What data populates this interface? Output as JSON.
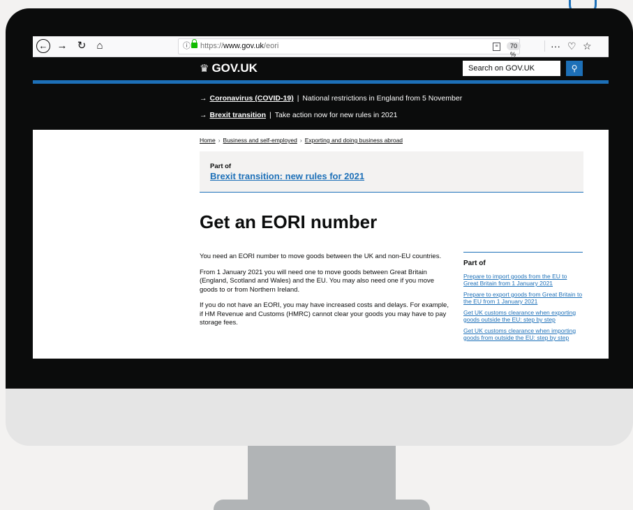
{
  "browser": {
    "url_prefix": "https://",
    "url_domain": "www.gov.uk",
    "url_path": "/eori",
    "zoom": "70 %"
  },
  "header": {
    "logo_text": "GOV.UK",
    "search_placeholder": "Search on GOV.UK"
  },
  "notices": [
    {
      "link": "Coronavirus (COVID-19)",
      "text": "National restrictions in England from 5 November"
    },
    {
      "link": "Brexit transition",
      "text": "Take action now for new rules in 2021"
    }
  ],
  "breadcrumb": [
    "Home",
    "Business and self-employed",
    "Exporting and doing business abroad"
  ],
  "part_of": {
    "label": "Part of",
    "link": "Brexit transition: new rules for 2021"
  },
  "page_title": "Get an EORI number",
  "body": [
    "You need an EORI number to move goods between the UK and non-EU countries.",
    "From 1 January 2021 you will need one to move goods between Great Britain (England, Scotland and Wales) and the EU. You may also need one if you move goods to or from Northern Ireland.",
    "If you do not have an EORI, you may have increased costs and delays. For example, if HM Revenue and Customs (HMRC) cannot clear your goods you may have to pay storage fees."
  ],
  "related": {
    "heading": "Part of",
    "links": [
      "Prepare to import goods from the EU to Great Britain from 1 January 2021",
      "Prepare to export goods from Great Britain to the EU from 1 January 2021",
      "Get UK customs clearance when exporting goods outside the EU: step by step",
      "Get UK customs clearance when importing goods from outside the EU: step by step"
    ]
  },
  "colors": {
    "gov_black": "#0b0c0c",
    "gov_blue": "#1d70b8",
    "light_grey": "#f3f2f1"
  }
}
